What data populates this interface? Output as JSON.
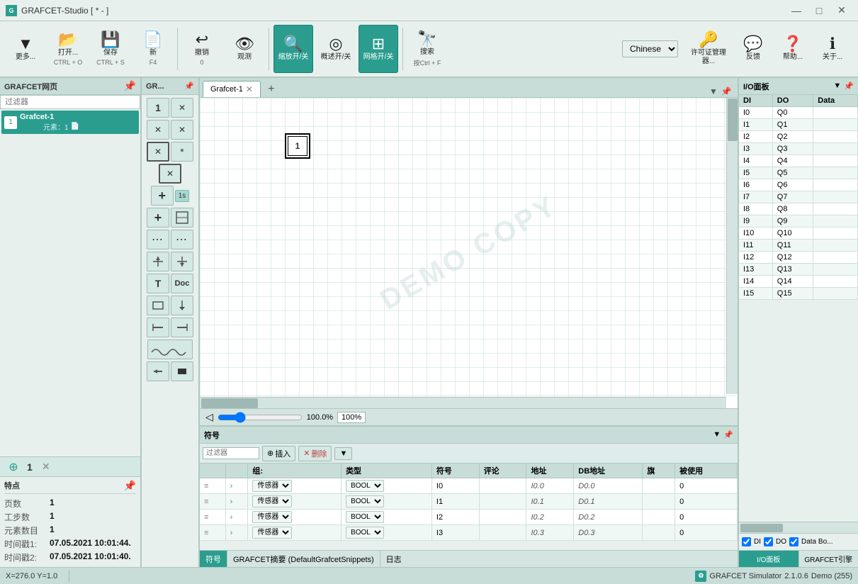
{
  "titlebar": {
    "title": "GRAFCET-Studio [ * - ]",
    "app_icon": "G",
    "min_btn": "—",
    "max_btn": "□",
    "close_btn": "✕"
  },
  "toolbar": {
    "buttons": [
      {
        "id": "more",
        "icon": "▼",
        "label": "更多...",
        "shortcut": "",
        "active": false
      },
      {
        "id": "open",
        "icon": "📂",
        "label": "打开...",
        "shortcut": "CTRL + O",
        "active": false
      },
      {
        "id": "save",
        "icon": "💾",
        "label": "保存",
        "shortcut": "CTRL + S",
        "active": false
      },
      {
        "id": "new",
        "icon": "📄",
        "label": "新",
        "shortcut": "F4",
        "active": false
      },
      {
        "id": "undo",
        "icon": "↩",
        "label": "撤销",
        "shortcut": "0",
        "active": false
      },
      {
        "id": "view",
        "icon": "👁",
        "label": "观测",
        "shortcut": "",
        "active": false
      },
      {
        "id": "zoom",
        "icon": "🔍",
        "label": "缩放开/关",
        "shortcut": "",
        "active": true
      },
      {
        "id": "overview",
        "icon": "◎",
        "label": "概述开/关",
        "shortcut": "",
        "active": false
      },
      {
        "id": "grid",
        "icon": "⊞",
        "label": "网格开/关",
        "shortcut": "",
        "active": true
      },
      {
        "id": "search",
        "icon": "🔭",
        "label": "搜索",
        "shortcut": "按Ctrl + F",
        "active": false
      }
    ],
    "language_label": "Chinese",
    "license_label": "许可证管理器...",
    "feedback_label": "反馈",
    "help_label": "帮助...",
    "about_label": "关于..."
  },
  "left_panel": {
    "header": "GRAFCET网页",
    "filter_placeholder": "过滤器",
    "tree_items": [
      {
        "num": "1",
        "name": "Grafcet-1",
        "sub": "元素：1"
      }
    ]
  },
  "bottom_controls": {
    "add_label": "+",
    "count": "1",
    "delete_label": "✕"
  },
  "properties": {
    "header": "特点",
    "rows": [
      {
        "key": "页数",
        "val": "1"
      },
      {
        "key": "工步数",
        "val": "1"
      },
      {
        "key": "元素数目",
        "val": "1"
      },
      {
        "key": "时间戳1:",
        "val": "07.05.2021 10:01:44."
      },
      {
        "key": "时间戳2:",
        "val": "07.05.2021 10:01:40."
      }
    ]
  },
  "tool_panel": {
    "header": "GR...",
    "tools": [
      {
        "id": "step-num",
        "icon": "1",
        "type": "num"
      },
      {
        "id": "step-close",
        "icon": "✕",
        "type": "x"
      },
      {
        "id": "trans-x",
        "icon": "✕",
        "type": "x"
      },
      {
        "id": "trans-x2",
        "icon": "✕",
        "type": "x"
      },
      {
        "id": "cond-x",
        "icon": "✕",
        "type": "x-box"
      },
      {
        "id": "cond-star",
        "icon": "*",
        "type": "star"
      },
      {
        "id": "cond-box-x",
        "icon": "✕",
        "type": "box-x"
      },
      {
        "id": "add-step",
        "icon": "+",
        "type": "plus"
      },
      {
        "id": "time-1s",
        "text": "1s",
        "type": "time"
      },
      {
        "id": "add-step2",
        "icon": "+",
        "type": "plus"
      },
      {
        "id": "step-icon",
        "type": "step-icon"
      },
      {
        "id": "dots-row",
        "type": "dots"
      },
      {
        "id": "dots-row2",
        "type": "dots"
      },
      {
        "id": "fork-icon",
        "type": "fork"
      },
      {
        "id": "text-doc",
        "type": "text-doc"
      },
      {
        "id": "shape1",
        "type": "shape1"
      },
      {
        "id": "shape2",
        "type": "shape2"
      },
      {
        "id": "line1",
        "type": "line1"
      },
      {
        "id": "wave-icon",
        "type": "wave"
      },
      {
        "id": "arrow-back",
        "type": "back"
      },
      {
        "id": "rect-black",
        "type": "rect-black"
      }
    ]
  },
  "canvas": {
    "tab_label": "Grafcet-1",
    "zoom_percent": "100.0%",
    "zoom_box": "100%",
    "step_number": "1",
    "watermark": "DEMO COPY"
  },
  "symbol_panel": {
    "header": "符号",
    "filter_placeholder": "过滤器",
    "insert_label": "插入",
    "delete_label": "删除",
    "columns": [
      "组:",
      "类型",
      "符号",
      "评论",
      "地址",
      "DB地址",
      "旗",
      "被使用"
    ],
    "rows": [
      {
        "type": "传感器",
        "dtype": "BOOL",
        "symbol": "I0",
        "comment": "",
        "address": "I0.0",
        "db": "D0.0",
        "flag": "",
        "used": "0"
      },
      {
        "type": "传感器",
        "dtype": "BOOL",
        "symbol": "I1",
        "comment": "",
        "address": "I0.1",
        "db": "D0.1",
        "flag": "",
        "used": "0"
      },
      {
        "type": "传感器",
        "dtype": "BOOL",
        "symbol": "I2",
        "comment": "",
        "address": "I0.2",
        "db": "D0.2",
        "flag": "",
        "used": "0"
      },
      {
        "type": "传感器",
        "dtype": "BOOL",
        "symbol": "I3",
        "comment": "",
        "address": "I0.3",
        "db": "D0.3",
        "flag": "",
        "used": "0"
      }
    ]
  },
  "bottom_tabs": [
    {
      "label": "符号",
      "active": true
    },
    {
      "label": "GRAFCET摘要 (DefaultGrafcetSnippets)",
      "active": false
    },
    {
      "label": "日志",
      "active": false
    }
  ],
  "io_panel": {
    "header": "I/O面板",
    "columns": [
      "DI",
      "DO",
      "Data"
    ],
    "rows": [
      {
        "di": "I0",
        "do": "Q0"
      },
      {
        "di": "I1",
        "do": "Q1"
      },
      {
        "di": "I2",
        "do": "Q2"
      },
      {
        "di": "I3",
        "do": "Q3"
      },
      {
        "di": "I4",
        "do": "Q4"
      },
      {
        "di": "I5",
        "do": "Q5"
      },
      {
        "di": "I6",
        "do": "Q6"
      },
      {
        "di": "I7",
        "do": "Q7"
      },
      {
        "di": "I8",
        "do": "Q8"
      },
      {
        "di": "I9",
        "do": "Q9"
      },
      {
        "di": "I10",
        "do": "Q10"
      },
      {
        "di": "I11",
        "do": "Q11"
      },
      {
        "di": "I12",
        "do": "Q12"
      },
      {
        "di": "I13",
        "do": "Q13"
      },
      {
        "di": "I14",
        "do": "Q14"
      },
      {
        "di": "I15",
        "do": "Q15"
      }
    ],
    "checkboxes": [
      "DI",
      "DO",
      "Data Bo..."
    ],
    "io_tabs": [
      "I/O面板",
      "GRAFCET引擎"
    ]
  },
  "statusbar": {
    "coords": "X=276.0  Y=1.0",
    "app_name": "GRAFCET Simulator",
    "version": "2.1.0.6",
    "mode": "Demo (255)"
  }
}
